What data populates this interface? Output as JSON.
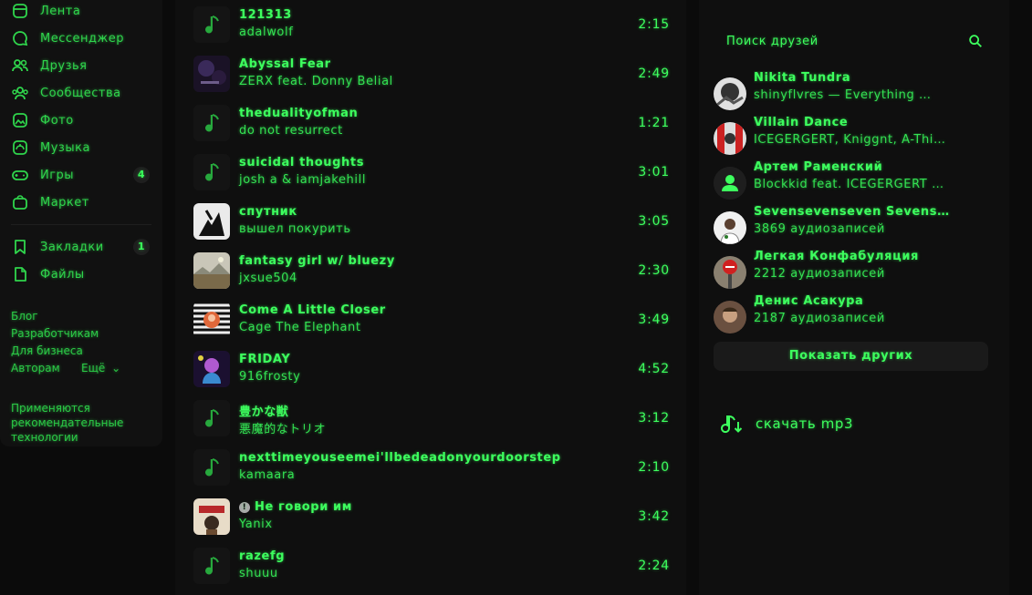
{
  "sidebar": {
    "items": [
      {
        "label": "Лента",
        "icon": "feed-icon"
      },
      {
        "label": "Мессенджер",
        "icon": "message-icon"
      },
      {
        "label": "Друзья",
        "icon": "friends-icon"
      },
      {
        "label": "Сообщества",
        "icon": "communities-icon"
      },
      {
        "label": "Фото",
        "icon": "photo-icon"
      },
      {
        "label": "Музыка",
        "icon": "music-icon"
      },
      {
        "label": "Игры",
        "icon": "gamepad-icon",
        "badge": "4"
      },
      {
        "label": "Маркет",
        "icon": "market-icon"
      },
      {
        "label": "Закладки",
        "icon": "bookmark-icon",
        "badge": "1"
      },
      {
        "label": "Файлы",
        "icon": "files-icon"
      }
    ],
    "footer": {
      "links": [
        "Блог",
        "Разработчикам",
        "Для бизнеса",
        "Авторам",
        "Ещё"
      ],
      "more_chevron": "⌄",
      "tech": "Применяются рекомендательные технологии"
    }
  },
  "tracks": [
    {
      "title": "121313",
      "artist": "adalwolf",
      "duration": "2:15",
      "cover": "note"
    },
    {
      "title": "Abyssal Fear",
      "artist": "ZERX feat. Donny Belial",
      "duration": "2:49",
      "cover": "dark-purple"
    },
    {
      "title": "thedualityofman",
      "artist": "do not resurrect",
      "duration": "1:21",
      "cover": "note"
    },
    {
      "title": "suicidal thoughts",
      "artist": "josh a & iamjakehill",
      "duration": "3:01",
      "cover": "note"
    },
    {
      "title": "спутник",
      "artist": "вышел покурить",
      "duration": "3:05",
      "cover": "bw"
    },
    {
      "title": "fantasy girl w/ bluezy",
      "artist": "jxsue504",
      "duration": "2:30",
      "cover": "landscape"
    },
    {
      "title": "Come A Little Closer",
      "artist": "Cage The Elephant",
      "duration": "3:49",
      "cover": "stripes"
    },
    {
      "title": "FRIDAY",
      "artist": "916frosty",
      "duration": "4:52",
      "cover": "colorful"
    },
    {
      "title": "豊かな獣",
      "artist": "悪魔的なトリオ",
      "duration": "3:12",
      "cover": "note"
    },
    {
      "title": "nexttimeyouseemei'llbedeadonyourdoorstep",
      "artist": "kamaara",
      "duration": "2:10",
      "cover": "note"
    },
    {
      "title": "Не говори им",
      "artist": "Yanix",
      "duration": "3:42",
      "cover": "poster",
      "explicit": true,
      "explicit_mark": "!"
    },
    {
      "title": "razefg",
      "artist": "shuuu",
      "duration": "2:24",
      "cover": "note"
    }
  ],
  "friends_panel": {
    "search_placeholder": "Поиск друзей",
    "friends": [
      {
        "name": "Nikita Tundra",
        "subtitle": "shinyflvres — Everything …",
        "avatar": "gray"
      },
      {
        "name": "Villain Dance",
        "subtitle": "ICEGERGERT, Kniggnt, A-Thi…",
        "avatar": "red"
      },
      {
        "name": "Артем Раменский",
        "subtitle": "Blockkid feat. ICEGERGERT …",
        "avatar": "default"
      },
      {
        "name": "Sevensevenseven Sevens…",
        "subtitle": "3869 аудиозаписей",
        "avatar": "light"
      },
      {
        "name": "Легкая Конфабуляция",
        "subtitle": "2212 аудиозаписей",
        "avatar": "sign"
      },
      {
        "name": "Денис Асакура",
        "subtitle": "2187 аудиозаписей",
        "avatar": "brown"
      }
    ],
    "show_more": "Показать других",
    "download": "скачать mp3"
  },
  "colors": {
    "accent": "#3dff5e",
    "background": "#0b0b0b",
    "panel": "#0f0f0f"
  }
}
